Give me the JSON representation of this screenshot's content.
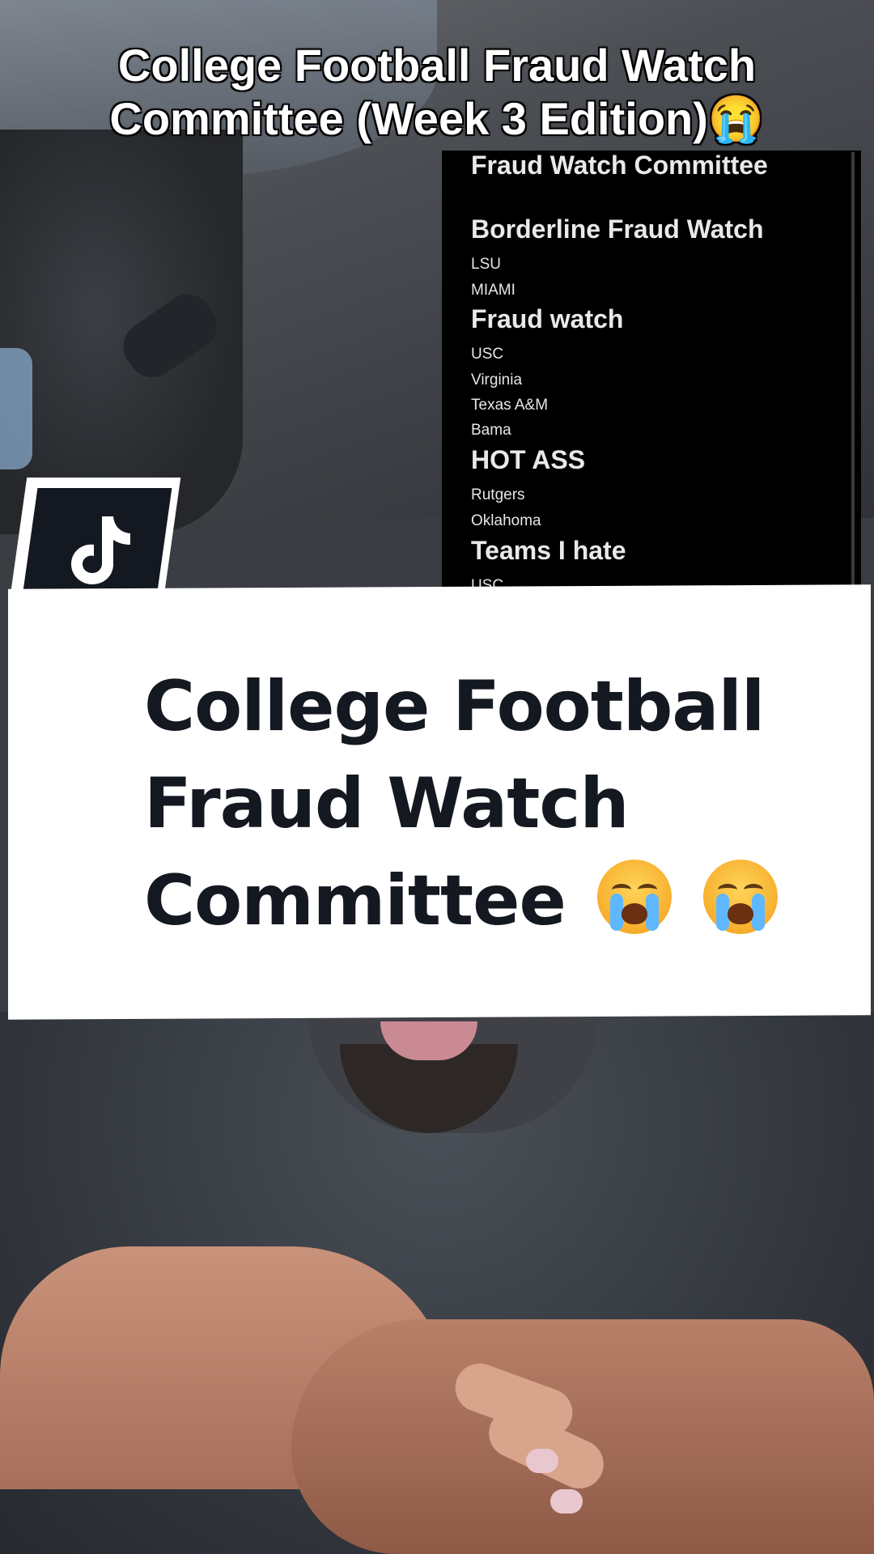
{
  "caption": {
    "line1": "College Football Fraud Watch",
    "line2": "Committee (Week 3 Edition)😭"
  },
  "notes": {
    "title": "Fraud Watch Committee",
    "sections": [
      {
        "heading": "Borderline Fraud Watch",
        "items": [
          "LSU",
          "MIAMI"
        ]
      },
      {
        "heading": "Fraud watch",
        "items": [
          "USC",
          "Virginia",
          "Texas A&M",
          "Bama"
        ]
      },
      {
        "heading": "HOT ASS",
        "items": [
          "Rutgers",
          "Oklahoma"
        ]
      },
      {
        "heading": "Teams I hate",
        "items": [
          "USC"
        ]
      }
    ]
  },
  "headline": {
    "line1": "College Football",
    "line2": "Fraud Watch",
    "line3": "Committee",
    "emoji": "loudly-crying-face"
  },
  "logo": {
    "icon": "tiktok-icon"
  },
  "colors": {
    "headline_text": "#141820",
    "notes_bg": "#000000",
    "card_bg": "#ffffff"
  }
}
